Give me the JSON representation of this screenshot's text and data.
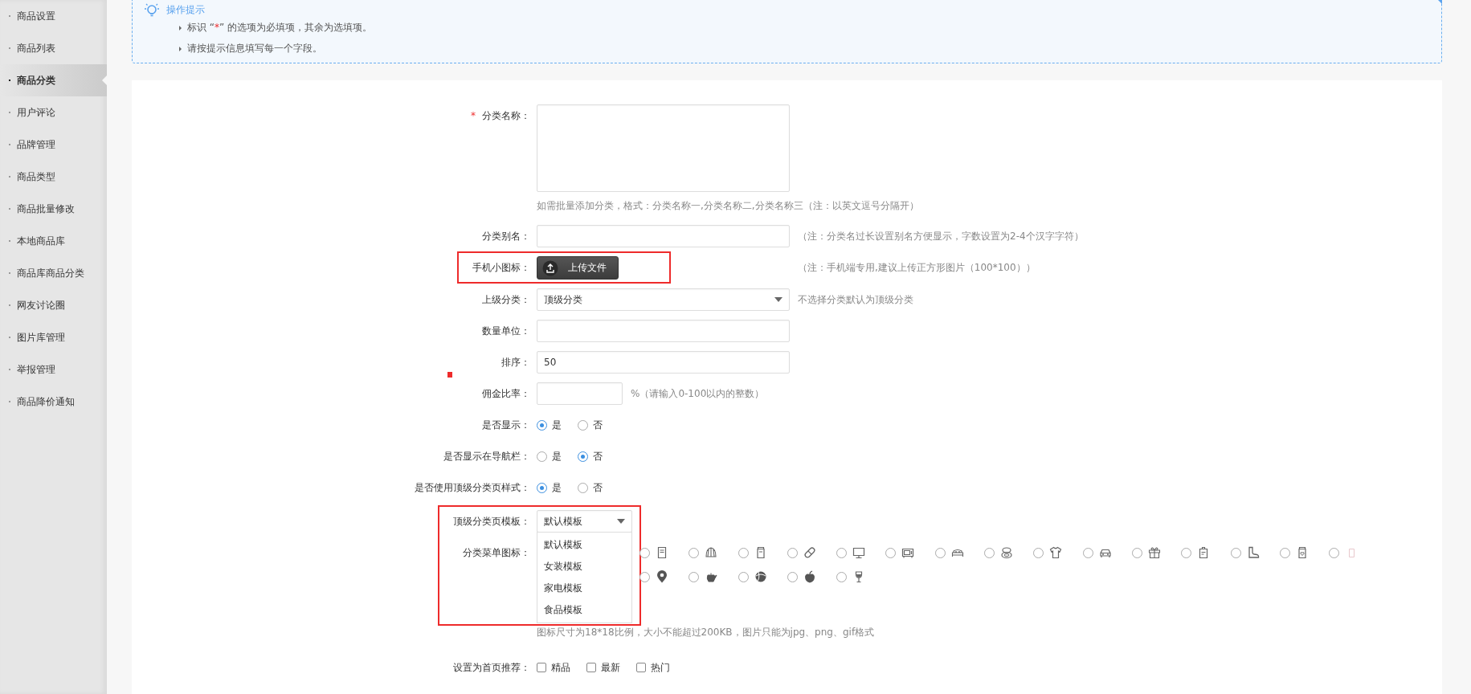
{
  "sidebar": {
    "items": [
      {
        "label": "商品设置",
        "selected": false
      },
      {
        "label": "商品列表",
        "selected": false
      },
      {
        "label": "商品分类",
        "selected": true
      },
      {
        "label": "用户评论",
        "selected": false
      },
      {
        "label": "品牌管理",
        "selected": false
      },
      {
        "label": "商品类型",
        "selected": false
      },
      {
        "label": "商品批量修改",
        "selected": false
      },
      {
        "label": "本地商品库",
        "selected": false
      },
      {
        "label": "商品库商品分类",
        "selected": false
      },
      {
        "label": "网友讨论圈",
        "selected": false
      },
      {
        "label": "图片库管理",
        "selected": false
      },
      {
        "label": "举报管理",
        "selected": false
      },
      {
        "label": "商品降价通知",
        "selected": false
      }
    ]
  },
  "tips": {
    "title": "操作提示",
    "lines": [
      [
        {
          "text": "标识 “"
        },
        {
          "text": "*",
          "kind": "required"
        },
        {
          "text": "” 的选项为必填项，其余为选填项。"
        }
      ],
      [
        {
          "text": "请按提示信息填写每一个字段。"
        }
      ]
    ]
  },
  "form": {
    "rows": [
      {
        "kind": "textarea",
        "label": "分类名称：",
        "required": true,
        "hint": "如需批量添加分类，格式：分类名称一,分类名称二,分类名称三（注：以英文逗号分隔开）"
      },
      {
        "kind": "text",
        "label": "分类别名：",
        "hint": "（注：分类名过长设置别名方便显示，字数设置为2-4个汉字字符）"
      },
      {
        "kind": "upload",
        "label": "手机小图标：",
        "button": "上传文件",
        "hint": "（注：手机端专用,建议上传正方形图片（100*100））",
        "highlight": true
      },
      {
        "kind": "select",
        "label": "上级分类：",
        "value": "顶级分类",
        "hint": "不选择分类默认为顶级分类"
      },
      {
        "kind": "text",
        "label": "数量单位："
      },
      {
        "kind": "text",
        "label": "排序：",
        "value": "50"
      },
      {
        "kind": "percent",
        "label": "佣金比率：",
        "hint": "%（请输入0-100以内的整数）"
      },
      {
        "kind": "radio",
        "label": "是否显示：",
        "options": [
          {
            "label": "是",
            "selected": true
          },
          {
            "label": "否",
            "selected": false
          }
        ]
      },
      {
        "kind": "radio",
        "label": "是否显示在导航栏：",
        "options": [
          {
            "label": "是",
            "selected": false
          },
          {
            "label": "否",
            "selected": true
          }
        ]
      },
      {
        "kind": "radio",
        "label": "是否使用顶级分类页样式：",
        "options": [
          {
            "label": "是",
            "selected": true
          },
          {
            "label": "否",
            "selected": false
          }
        ]
      },
      {
        "kind": "dropdown",
        "label": "顶级分类页模板：",
        "value": "默认模板",
        "expanded": true,
        "options": [
          "默认模板",
          "女装模板",
          "家电模板",
          "食品模板"
        ],
        "highlight": true
      },
      {
        "kind": "icons",
        "label": "分类菜单图标：",
        "rows": [
          [
            {
              "selected": false
            },
            {
              "selected": false
            },
            {
              "selected": false
            },
            {
              "selected": false
            },
            {
              "selected": false
            },
            {
              "selected": false
            },
            {
              "selected": false
            },
            {
              "selected": false
            },
            {
              "selected": false
            },
            {
              "selected": false
            },
            {
              "selected": false
            },
            {
              "selected": false
            },
            {
              "selected": false
            },
            {
              "selected": false
            },
            {
              "selected": false
            }
          ],
          [
            {
              "selected": false
            },
            {
              "selected": false
            },
            {
              "selected": false
            },
            {
              "selected": false
            },
            {
              "selected": false
            }
          ]
        ],
        "hint": "图标尺寸为18*18比例，大小不能超过200KB，图片只能为jpg、png、gif格式"
      },
      {
        "kind": "checkbox",
        "label": "设置为首页推荐：",
        "options": [
          {
            "label": "精品",
            "checked": false
          },
          {
            "label": "最新",
            "checked": false
          },
          {
            "label": "热门",
            "checked": false
          }
        ]
      }
    ]
  }
}
